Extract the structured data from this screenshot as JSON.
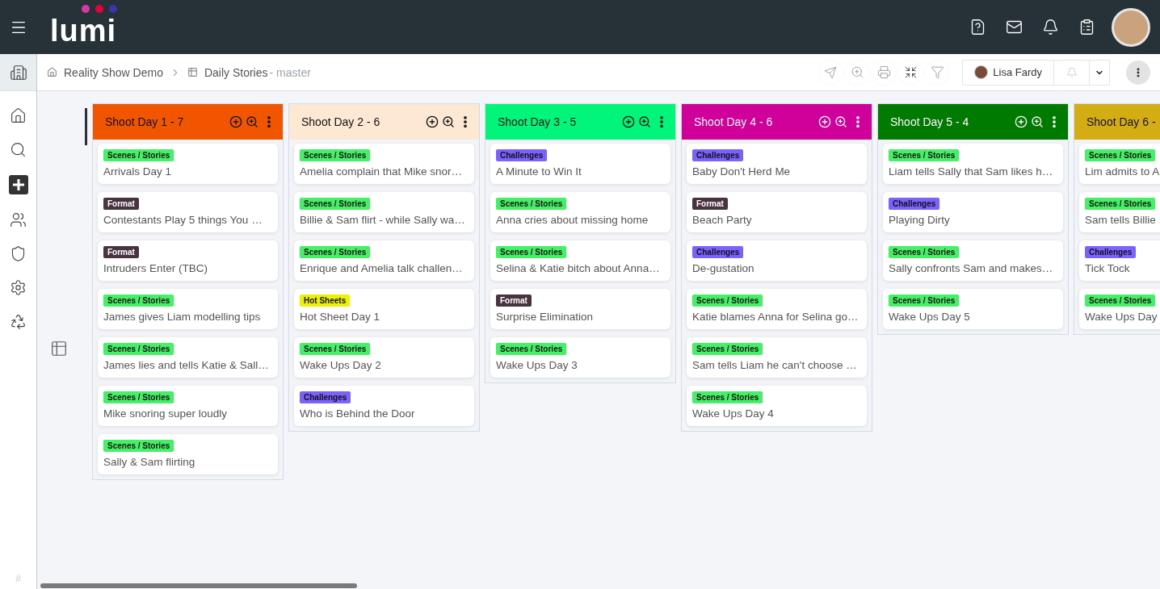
{
  "header": {
    "logo": "lumi"
  },
  "breadcrumb": {
    "items": [
      "Reality Show Demo",
      "Daily Stories"
    ],
    "branch": "- master"
  },
  "toolbar": {
    "user": "Lisa Fardy"
  },
  "sidebar_footer": "#",
  "columns": [
    {
      "title": "Shoot Day 1 - 7",
      "color": "#f25500",
      "kind": "full",
      "cards": [
        {
          "tag": {
            "label": "Scenes / Stories",
            "color": "#44f065"
          },
          "title": "Arrivals Day 1"
        },
        {
          "tag": {
            "label": "Format",
            "color": "#4a3340"
          },
          "title": "Contestants Play 5 things You …"
        },
        {
          "tag": {
            "label": "Format",
            "color": "#4a3340"
          },
          "title": "Intruders Enter (TBC)"
        },
        {
          "tag": {
            "label": "Scenes / Stories",
            "color": "#44f065"
          },
          "title": "James gives Liam modelling tips"
        },
        {
          "tag": {
            "label": "Scenes / Stories",
            "color": "#44f065"
          },
          "title": "James lies and tells Katie & Sall…"
        },
        {
          "tag": {
            "label": "Scenes / Stories",
            "color": "#44f065"
          },
          "title": "Mike snoring super loudly"
        },
        {
          "tag": {
            "label": "Scenes / Stories",
            "color": "#44f065"
          },
          "title": "Sally & Sam flirting"
        }
      ]
    },
    {
      "title": "Shoot Day 2 - 6",
      "color": "#fde8d4",
      "kind": "full",
      "cards": [
        {
          "tag": {
            "label": "Scenes / Stories",
            "color": "#44f065"
          },
          "title": "Amelia complain that Mike snor…"
        },
        {
          "tag": {
            "label": "Scenes / Stories",
            "color": "#44f065"
          },
          "title": "Billie & Sam flirt - while Sally wa…"
        },
        {
          "tag": {
            "label": "Scenes / Stories",
            "color": "#44f065"
          },
          "title": "Enrique and Amelia talk challen…"
        },
        {
          "tag": {
            "label": "Hot Sheets",
            "color": "#eef200"
          },
          "title": "Hot Sheet Day 1"
        },
        {
          "tag": {
            "label": "Scenes / Stories",
            "color": "#44f065"
          },
          "title": "Wake Ups Day 2"
        },
        {
          "tag": {
            "label": "Challenges",
            "color": "#7b61ff"
          },
          "title": "Who is Behind the Door"
        }
      ]
    },
    {
      "title": "Shoot Day 3 - 5",
      "color": "#00f57a",
      "kind": "full",
      "cards": [
        {
          "tag": {
            "label": "Challenges",
            "color": "#7b61ff"
          },
          "title": "A Minute to Win It"
        },
        {
          "tag": {
            "label": "Scenes / Stories",
            "color": "#44f065"
          },
          "title": "Anna cries about missing home"
        },
        {
          "tag": {
            "label": "Scenes / Stories",
            "color": "#44f065"
          },
          "title": "Selina & Katie bitch about Anna…"
        },
        {
          "tag": {
            "label": "Format",
            "color": "#4a3340"
          },
          "title": "Surprise Elimination"
        },
        {
          "tag": {
            "label": "Scenes / Stories",
            "color": "#44f065"
          },
          "title": "Wake Ups Day 3"
        }
      ]
    },
    {
      "title": "Shoot Day 4 - 6",
      "color": "#d0009b",
      "kind": "full",
      "cards": [
        {
          "tag": {
            "label": "Challenges",
            "color": "#7b61ff"
          },
          "title": "Baby Don't Herd Me"
        },
        {
          "tag": {
            "label": "Format",
            "color": "#4a3340"
          },
          "title": "Beach Party"
        },
        {
          "tag": {
            "label": "Challenges",
            "color": "#7b61ff"
          },
          "title": "De-gustation"
        },
        {
          "tag": {
            "label": "Scenes / Stories",
            "color": "#44f065"
          },
          "title": "Katie blames Anna for Selina go…"
        },
        {
          "tag": {
            "label": "Scenes / Stories",
            "color": "#44f065"
          },
          "title": "Sam tells Liam he can't choose …"
        },
        {
          "tag": {
            "label": "Scenes / Stories",
            "color": "#44f065"
          },
          "title": "Wake Ups Day 4"
        }
      ]
    },
    {
      "title": "Shoot Day 5 - 4",
      "color": "#007a00",
      "kind": "full",
      "cards": [
        {
          "tag": {
            "label": "Scenes / Stories",
            "color": "#44f065"
          },
          "title": "Liam tells Sally that Sam likes h…"
        },
        {
          "tag": {
            "label": "Challenges",
            "color": "#7b61ff"
          },
          "title": "Playing Dirty"
        },
        {
          "tag": {
            "label": "Scenes / Stories",
            "color": "#44f065"
          },
          "title": "Sally confronts Sam and makes…"
        },
        {
          "tag": {
            "label": "Scenes / Stories",
            "color": "#44f065"
          },
          "title": "Wake Ups Day 5"
        }
      ]
    },
    {
      "title": "Shoot Day 6 -",
      "color": "#d4ac14",
      "kind": "clipped",
      "cards": [
        {
          "tag": {
            "label": "Scenes / Stories",
            "color": "#44f065"
          },
          "title": "Lim admits to A"
        },
        {
          "tag": {
            "label": "Scenes / Stories",
            "color": "#44f065"
          },
          "title": "Sam tells Billie"
        },
        {
          "tag": {
            "label": "Challenges",
            "color": "#7b61ff"
          },
          "title": "Tick Tock"
        },
        {
          "tag": {
            "label": "Scenes / Stories",
            "color": "#44f065"
          },
          "title": "Wake Ups Day"
        }
      ]
    }
  ]
}
